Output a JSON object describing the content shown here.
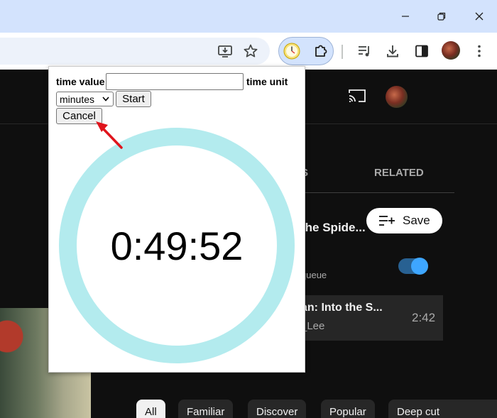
{
  "colors": {
    "titlebar": "#d3e3fd",
    "toolbar": "#ffffff",
    "youtube_background": "#0f0f0f",
    "ring": "#b3ebee",
    "toggle": "#3ea6ff",
    "annotation_arrow": "#e0141c"
  },
  "window_controls": {
    "icons": [
      "minimize-icon",
      "restore-icon",
      "close-icon"
    ]
  },
  "toolbar": {
    "icons": [
      "install-app-icon",
      "bookmark-star-icon",
      "timer-extension-icon",
      "extensions-puzzle-icon",
      "media-controls-icon",
      "download-icon",
      "side-panel-icon",
      "profile-avatar",
      "more-menu-icon"
    ]
  },
  "youtube": {
    "tabs": {
      "partial": "S",
      "related": "RELATED"
    },
    "video_title_fragment": "the Spide...",
    "queue_fragment": "queue",
    "save_label": "Save",
    "playlist_item": {
      "title_fragment": "an: Into the S...",
      "channel_fragment": "_Lee",
      "duration": "2:42"
    },
    "chips": [
      "All",
      "Familiar",
      "Discover",
      "Popular",
      "Deep cut"
    ]
  },
  "popup": {
    "time_value_label": "time value",
    "time_value_input": "",
    "time_unit_label": "time unit",
    "unit_selected": "minutes",
    "start_label": "Start",
    "cancel_label": "Cancel",
    "timer_display": "0:49:52"
  }
}
